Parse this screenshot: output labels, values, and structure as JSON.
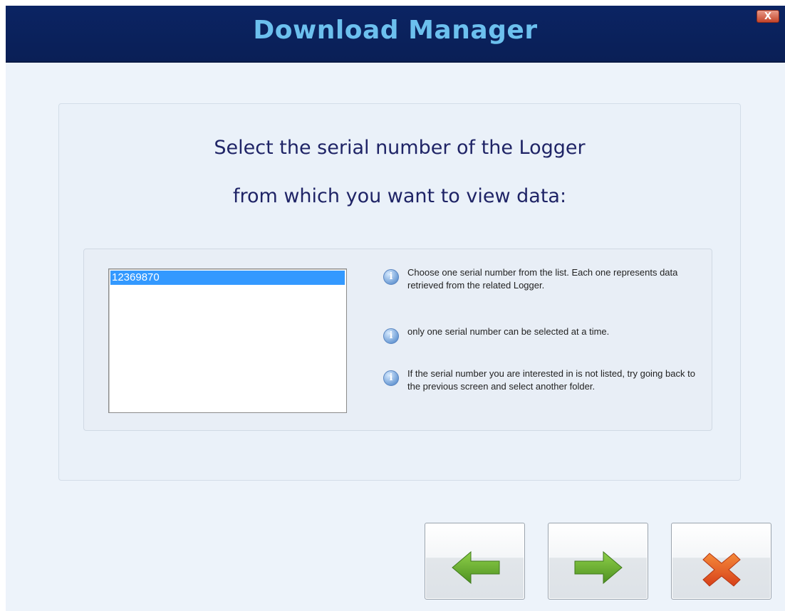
{
  "window": {
    "title": "Download Manager",
    "close_label": "X"
  },
  "heading": {
    "line1": "Select the serial number of the Logger",
    "line2": "from which you want to view data:"
  },
  "serial_list": {
    "items": [
      "12369870"
    ],
    "selected": "12369870"
  },
  "info": [
    {
      "icon": "info-icon",
      "text": "Choose one serial number from the list. Each one represents data retrieved from the related Logger."
    },
    {
      "icon": "info-icon",
      "text": "only one serial number can be selected at a time."
    },
    {
      "icon": "info-icon",
      "text": "If the serial number you are interested in is not listed, try going back to the previous screen and select another folder."
    }
  ],
  "buttons": {
    "back": {
      "icon": "arrow-left-icon",
      "color": "#5fa52a"
    },
    "next": {
      "icon": "arrow-right-icon",
      "color": "#5fa52a"
    },
    "cancel": {
      "icon": "cross-icon",
      "color": "#e2591e"
    }
  },
  "colors": {
    "titlebar": "#0b2463",
    "title_text": "#6cc0ee",
    "heading_text": "#1f2466",
    "selection": "#3399ff"
  }
}
